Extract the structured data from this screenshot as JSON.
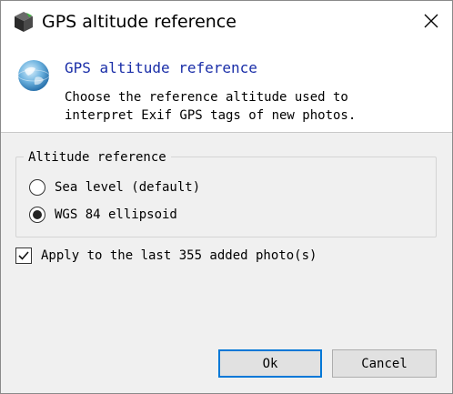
{
  "window": {
    "title": "GPS altitude reference",
    "icon": "app-cube-icon",
    "close_icon": "close-icon"
  },
  "header": {
    "icon": "globe-icon",
    "title": "GPS altitude reference",
    "description": "Choose the reference altitude used to\ninterpret Exif GPS tags of new photos."
  },
  "altitude_group": {
    "legend": "Altitude reference",
    "options": [
      {
        "label": "Sea level (default)",
        "selected": false
      },
      {
        "label": "WGS 84 ellipsoid",
        "selected": true
      }
    ]
  },
  "apply_checkbox": {
    "label": "Apply to the last 355 added photo(s)",
    "checked": true
  },
  "buttons": {
    "ok_label": "Ok",
    "cancel_label": "Cancel"
  },
  "colors": {
    "header_title": "#1a2ea8",
    "default_button_border": "#0078d7",
    "dialog_background": "#f0f0f0"
  }
}
